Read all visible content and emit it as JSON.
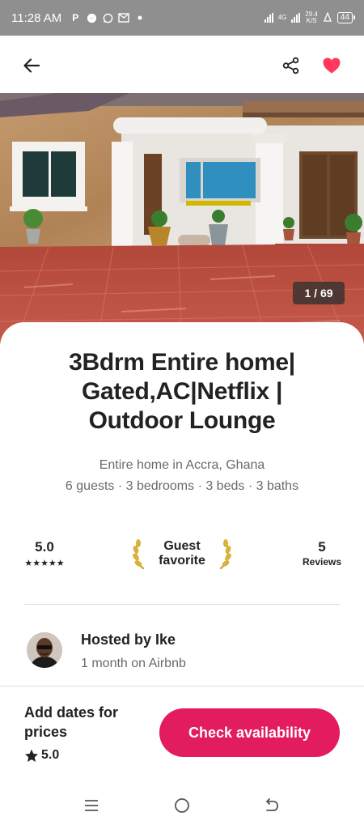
{
  "status_bar": {
    "time": "11:28 AM",
    "network_label": "4G",
    "speed_value": "29.4",
    "speed_unit": "K/S",
    "battery": "44"
  },
  "header": {
    "icons": [
      "back-arrow-icon",
      "share-icon",
      "heart-icon"
    ],
    "favorite_color": "#ff385c"
  },
  "photo": {
    "counter": "1 / 69"
  },
  "listing": {
    "title_lines": [
      "3Bdrm Entire home|",
      "Gated,AC|Netflix |",
      "Outdoor Lounge"
    ],
    "subtitle": "Entire home in Accra, Ghana",
    "details": "6 guests · 3 bedrooms · 3 beds · 3 baths"
  },
  "highlights": {
    "rating": "5.0",
    "stars": "★★★★★",
    "guest_favorite_lines": [
      "Guest",
      "favorite"
    ],
    "reviews_count": "5",
    "reviews_label": "Reviews"
  },
  "host": {
    "name": "Hosted by Ike",
    "tenure": "1 month on Airbnb"
  },
  "footer": {
    "prompt_lines": [
      "Add dates for",
      "prices"
    ],
    "rating": "5.0",
    "button_label": "Check availability",
    "button_color": "#e31c5f"
  },
  "nav_bar": {
    "icons": [
      "recents-icon",
      "home-icon",
      "back-icon"
    ]
  }
}
